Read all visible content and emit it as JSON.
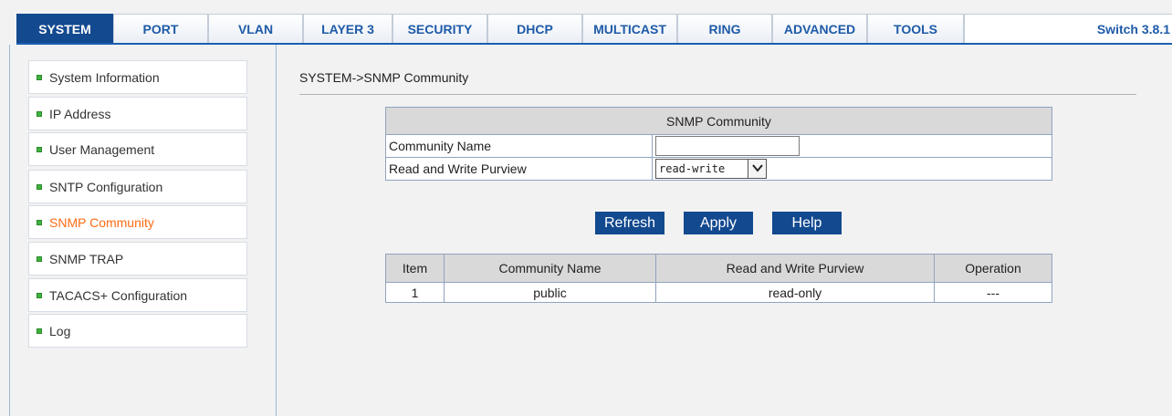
{
  "tabs": [
    "SYSTEM",
    "PORT",
    "VLAN",
    "LAYER 3",
    "SECURITY",
    "DHCP",
    "MULTICAST",
    "RING",
    "ADVANCED",
    "TOOLS"
  ],
  "version": "Switch 3.8.1",
  "nav": [
    "System Information",
    "IP Address",
    "User Management",
    "SNTP Configuration",
    "SNMP Community",
    "SNMP TRAP",
    "TACACS+ Configuration",
    "Log"
  ],
  "breadcrumb": "SYSTEM->SNMP Community",
  "form": {
    "title": "SNMP Community",
    "community_name_label": "Community Name",
    "community_name_value": "",
    "purview_label": "Read and Write Purview",
    "purview_value": "read-write"
  },
  "buttons": {
    "refresh": "Refresh",
    "apply": "Apply",
    "help": "Help"
  },
  "list": {
    "headers": [
      "Item",
      "Community Name",
      "Read and Write Purview",
      "Operation"
    ],
    "rows": [
      [
        "1",
        "public",
        "read-only",
        "---"
      ]
    ]
  },
  "colors": {
    "accent": "#13498f",
    "active_nav": "#ff6a13",
    "tab_text": "#1e5aa8"
  }
}
